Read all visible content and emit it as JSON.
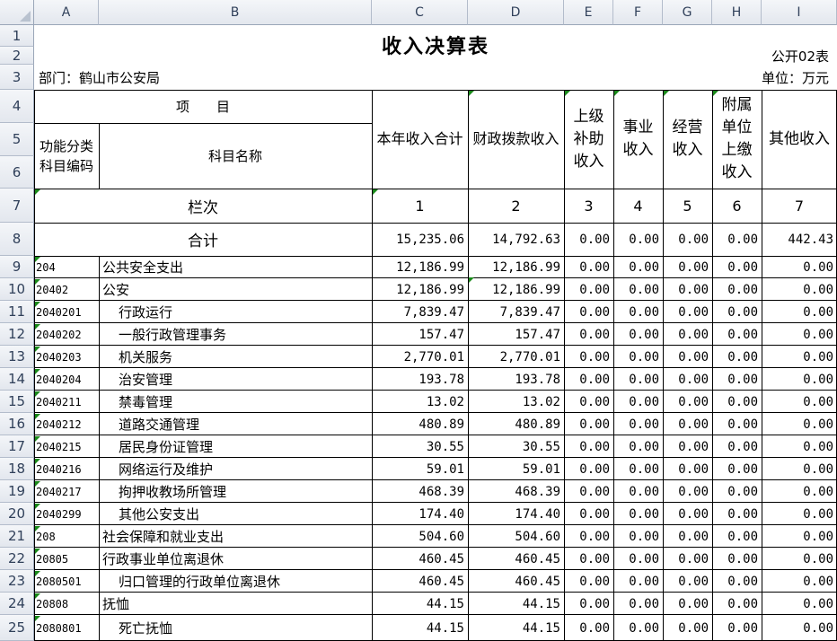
{
  "sheet": {
    "column_letters": [
      "A",
      "B",
      "C",
      "D",
      "E",
      "F",
      "G",
      "H",
      "I"
    ],
    "row_numbers": [
      "1",
      "2",
      "3",
      "4",
      "5",
      "6",
      "7",
      "8",
      "9",
      "10",
      "11",
      "12",
      "13",
      "14",
      "15",
      "16",
      "17",
      "18",
      "19",
      "20",
      "21",
      "22",
      "23",
      "24",
      "25"
    ],
    "title": "收入决算表",
    "form_number": "公开02表",
    "department": "部门：鹤山市公安局",
    "unit": "单位：万元",
    "header": {
      "item": "项　　目",
      "code": "功能分类科目编码",
      "name": "科目名称",
      "columns": [
        "本年收入合计",
        "财政拨款收入",
        "上级补助收入",
        "事业收入",
        "经营收入",
        "附属单位上缴收入",
        "其他收入"
      ],
      "seq_label": "栏次",
      "seq": [
        "1",
        "2",
        "3",
        "4",
        "5",
        "6",
        "7"
      ]
    },
    "total_label": "合计",
    "total": [
      "15,235.06",
      "14,792.63",
      "0.00",
      "0.00",
      "0.00",
      "0.00",
      "442.43"
    ],
    "rows": [
      {
        "code": "204",
        "name": "公共安全支出",
        "indent": 0,
        "values": [
          "12,186.99",
          "12,186.99",
          "0.00",
          "0.00",
          "0.00",
          "0.00",
          "0.00"
        ]
      },
      {
        "code": "20402",
        "name": "公安",
        "indent": 0,
        "values": [
          "12,186.99",
          "12,186.99",
          "0.00",
          "0.00",
          "0.00",
          "0.00",
          "0.00"
        ]
      },
      {
        "code": "2040201",
        "name": "行政运行",
        "indent": 1,
        "values": [
          "7,839.47",
          "7,839.47",
          "0.00",
          "0.00",
          "0.00",
          "0.00",
          "0.00"
        ]
      },
      {
        "code": "2040202",
        "name": "一般行政管理事务",
        "indent": 1,
        "values": [
          "157.47",
          "157.47",
          "0.00",
          "0.00",
          "0.00",
          "0.00",
          "0.00"
        ]
      },
      {
        "code": "2040203",
        "name": "机关服务",
        "indent": 1,
        "values": [
          "2,770.01",
          "2,770.01",
          "0.00",
          "0.00",
          "0.00",
          "0.00",
          "0.00"
        ]
      },
      {
        "code": "2040204",
        "name": "治安管理",
        "indent": 1,
        "values": [
          "193.78",
          "193.78",
          "0.00",
          "0.00",
          "0.00",
          "0.00",
          "0.00"
        ]
      },
      {
        "code": "2040211",
        "name": "禁毒管理",
        "indent": 1,
        "values": [
          "13.02",
          "13.02",
          "0.00",
          "0.00",
          "0.00",
          "0.00",
          "0.00"
        ]
      },
      {
        "code": "2040212",
        "name": "道路交通管理",
        "indent": 1,
        "values": [
          "480.89",
          "480.89",
          "0.00",
          "0.00",
          "0.00",
          "0.00",
          "0.00"
        ]
      },
      {
        "code": "2040215",
        "name": "居民身份证管理",
        "indent": 1,
        "values": [
          "30.55",
          "30.55",
          "0.00",
          "0.00",
          "0.00",
          "0.00",
          "0.00"
        ]
      },
      {
        "code": "2040216",
        "name": "网络运行及维护",
        "indent": 1,
        "values": [
          "59.01",
          "59.01",
          "0.00",
          "0.00",
          "0.00",
          "0.00",
          "0.00"
        ]
      },
      {
        "code": "2040217",
        "name": "拘押收教场所管理",
        "indent": 1,
        "values": [
          "468.39",
          "468.39",
          "0.00",
          "0.00",
          "0.00",
          "0.00",
          "0.00"
        ]
      },
      {
        "code": "2040299",
        "name": "其他公安支出",
        "indent": 1,
        "values": [
          "174.40",
          "174.40",
          "0.00",
          "0.00",
          "0.00",
          "0.00",
          "0.00"
        ]
      },
      {
        "code": "208",
        "name": "社会保障和就业支出",
        "indent": 0,
        "values": [
          "504.60",
          "504.60",
          "0.00",
          "0.00",
          "0.00",
          "0.00",
          "0.00"
        ]
      },
      {
        "code": "20805",
        "name": "行政事业单位离退休",
        "indent": 0,
        "values": [
          "460.45",
          "460.45",
          "0.00",
          "0.00",
          "0.00",
          "0.00",
          "0.00"
        ]
      },
      {
        "code": "2080501",
        "name": "归口管理的行政单位离退休",
        "indent": 1,
        "values": [
          "460.45",
          "460.45",
          "0.00",
          "0.00",
          "0.00",
          "0.00",
          "0.00"
        ]
      },
      {
        "code": "20808",
        "name": "抚恤",
        "indent": 0,
        "values": [
          "44.15",
          "44.15",
          "0.00",
          "0.00",
          "0.00",
          "0.00",
          "0.00"
        ]
      },
      {
        "code": "2080801",
        "name": "死亡抚恤",
        "indent": 1,
        "values": [
          "44.15",
          "44.15",
          "0.00",
          "0.00",
          "0.00",
          "0.00",
          "0.00"
        ]
      }
    ]
  }
}
